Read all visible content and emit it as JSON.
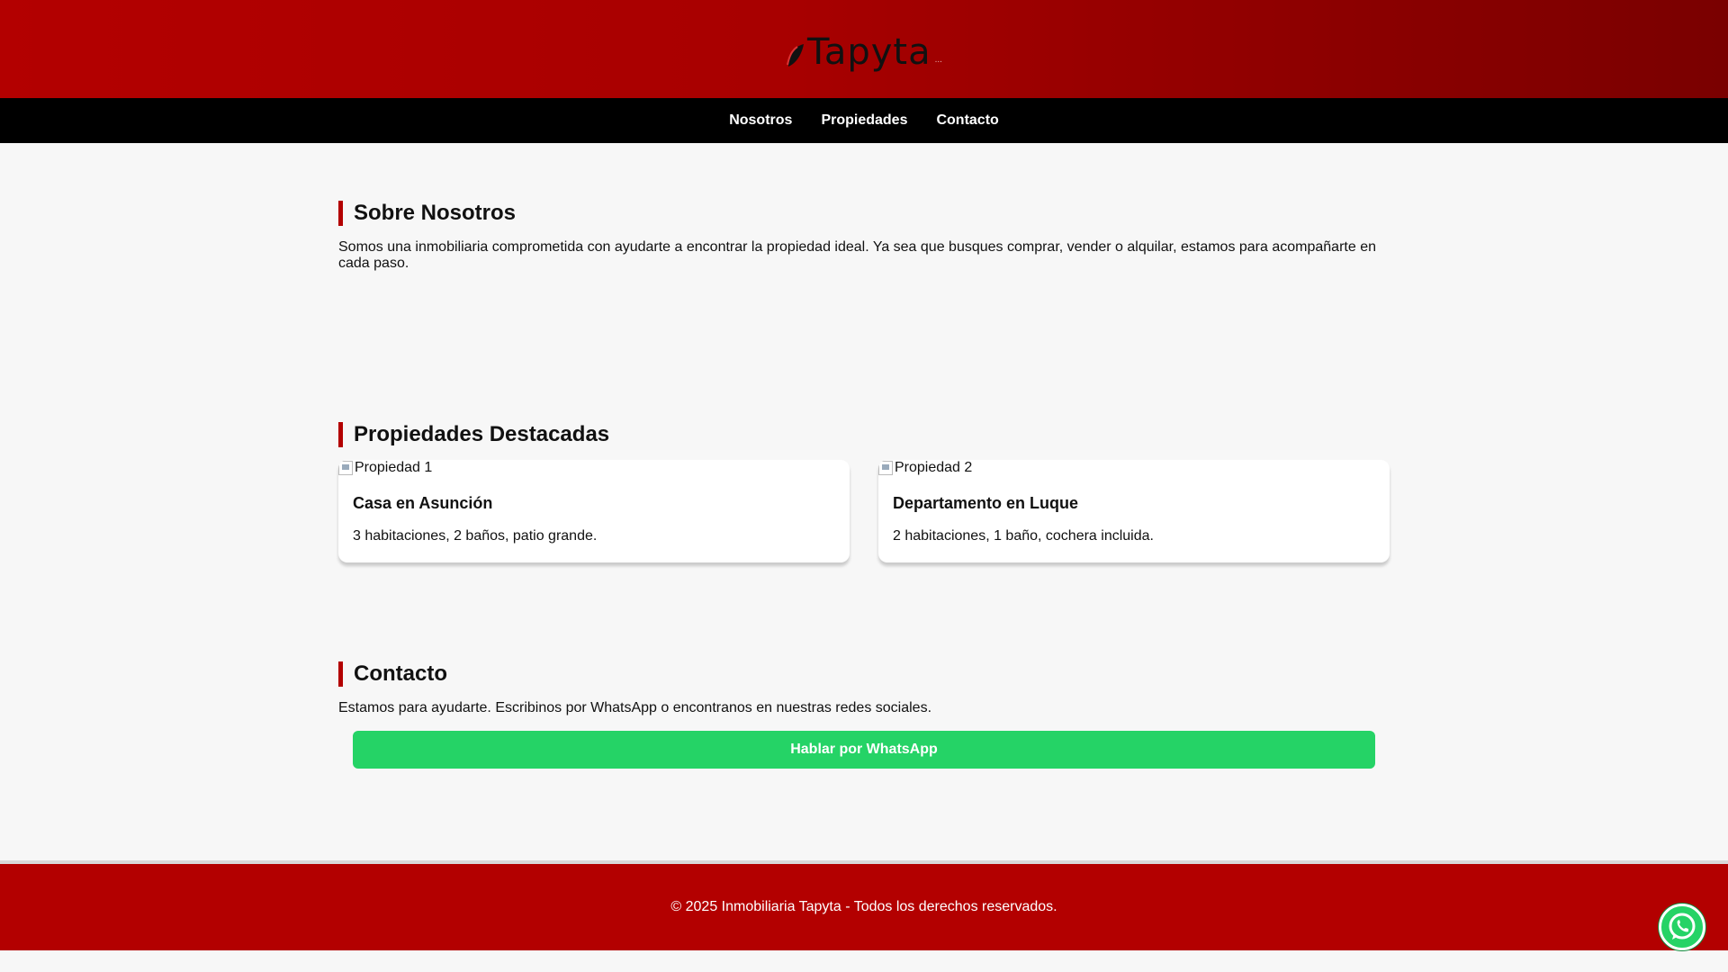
{
  "brand": {
    "name": "Tapyta",
    "logo_alt": "Tapyta"
  },
  "nav": {
    "items": [
      {
        "label": "Nosotros"
      },
      {
        "label": "Propiedades"
      },
      {
        "label": "Contacto"
      }
    ]
  },
  "about": {
    "title": "Sobre Nosotros",
    "text": "Somos una inmobiliaria comprometida con ayudarte a encontrar la propiedad ideal. Ya sea que busques comprar, vender o alquilar, estamos para acompañarte en cada paso."
  },
  "properties": {
    "title": "Propiedades Destacadas",
    "items": [
      {
        "image_alt": "Propiedad 1",
        "title": "Casa en Asunción",
        "description": "3 habitaciones, 2 baños, patio grande."
      },
      {
        "image_alt": "Propiedad 2",
        "title": "Departamento en Luque",
        "description": "2 habitaciones, 1 baño, cochera incluida."
      }
    ]
  },
  "contact": {
    "title": "Contacto",
    "text": "Estamos para ayudarte. Escribinos por WhatsApp o encontranos en nuestras redes sociales.",
    "button_label": "Hablar por WhatsApp"
  },
  "footer": {
    "text": "© 2025 Inmobiliaria Tapyta - Todos los derechos reservados."
  },
  "colors": {
    "brand_red": "#b30000",
    "nav_black": "#000000",
    "whatsapp_green": "#25d366"
  },
  "icons": {
    "floating_button": "whatsapp-icon"
  }
}
